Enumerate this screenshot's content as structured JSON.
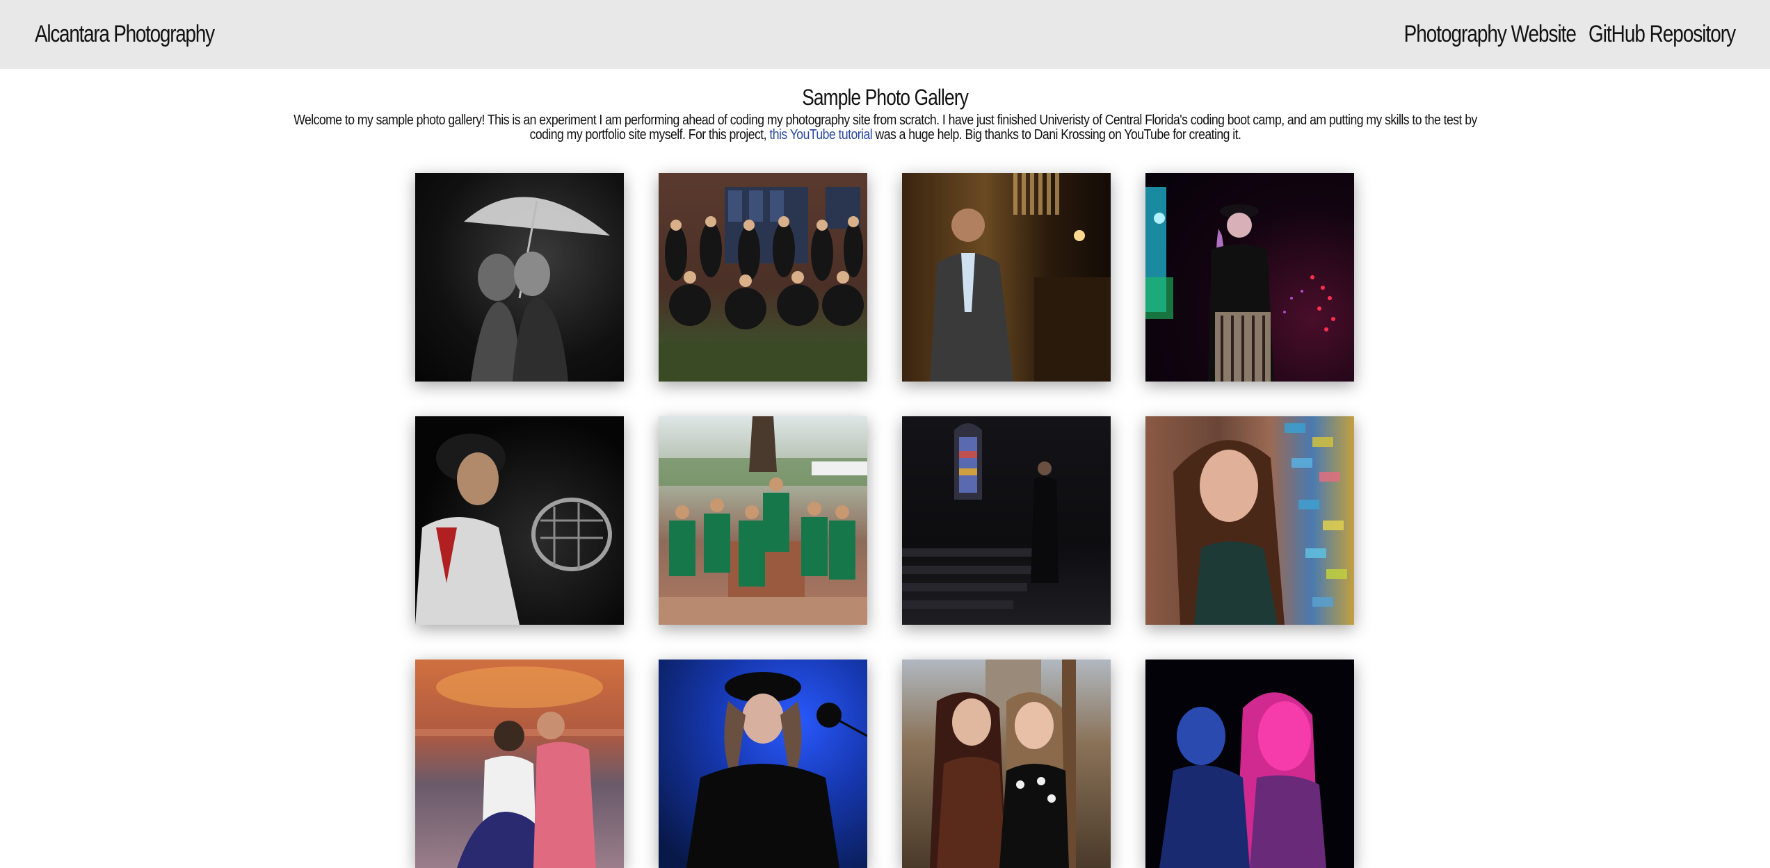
{
  "header": {
    "brand": "Alcantara Photography",
    "nav": [
      {
        "label": "Photography Website"
      },
      {
        "label": "GitHub Repository"
      }
    ]
  },
  "intro": {
    "title": "Sample Photo Gallery",
    "text_before": "Welcome to my sample photo gallery! This is an experiment I am performing ahead of coding my photography site from scratch. I have just finished Univeristy of Central Florida's coding boot camp, and am putting my skills to the test by coding my portfolio site myself. For this project, ",
    "link_text": "this YouTube tutorial",
    "text_after": " was a huge help. Big thanks to Dani Krossing on YouTube for creating it."
  },
  "colors": {
    "header_bg": "#e8e8e8",
    "link": "#2b4aa0"
  }
}
